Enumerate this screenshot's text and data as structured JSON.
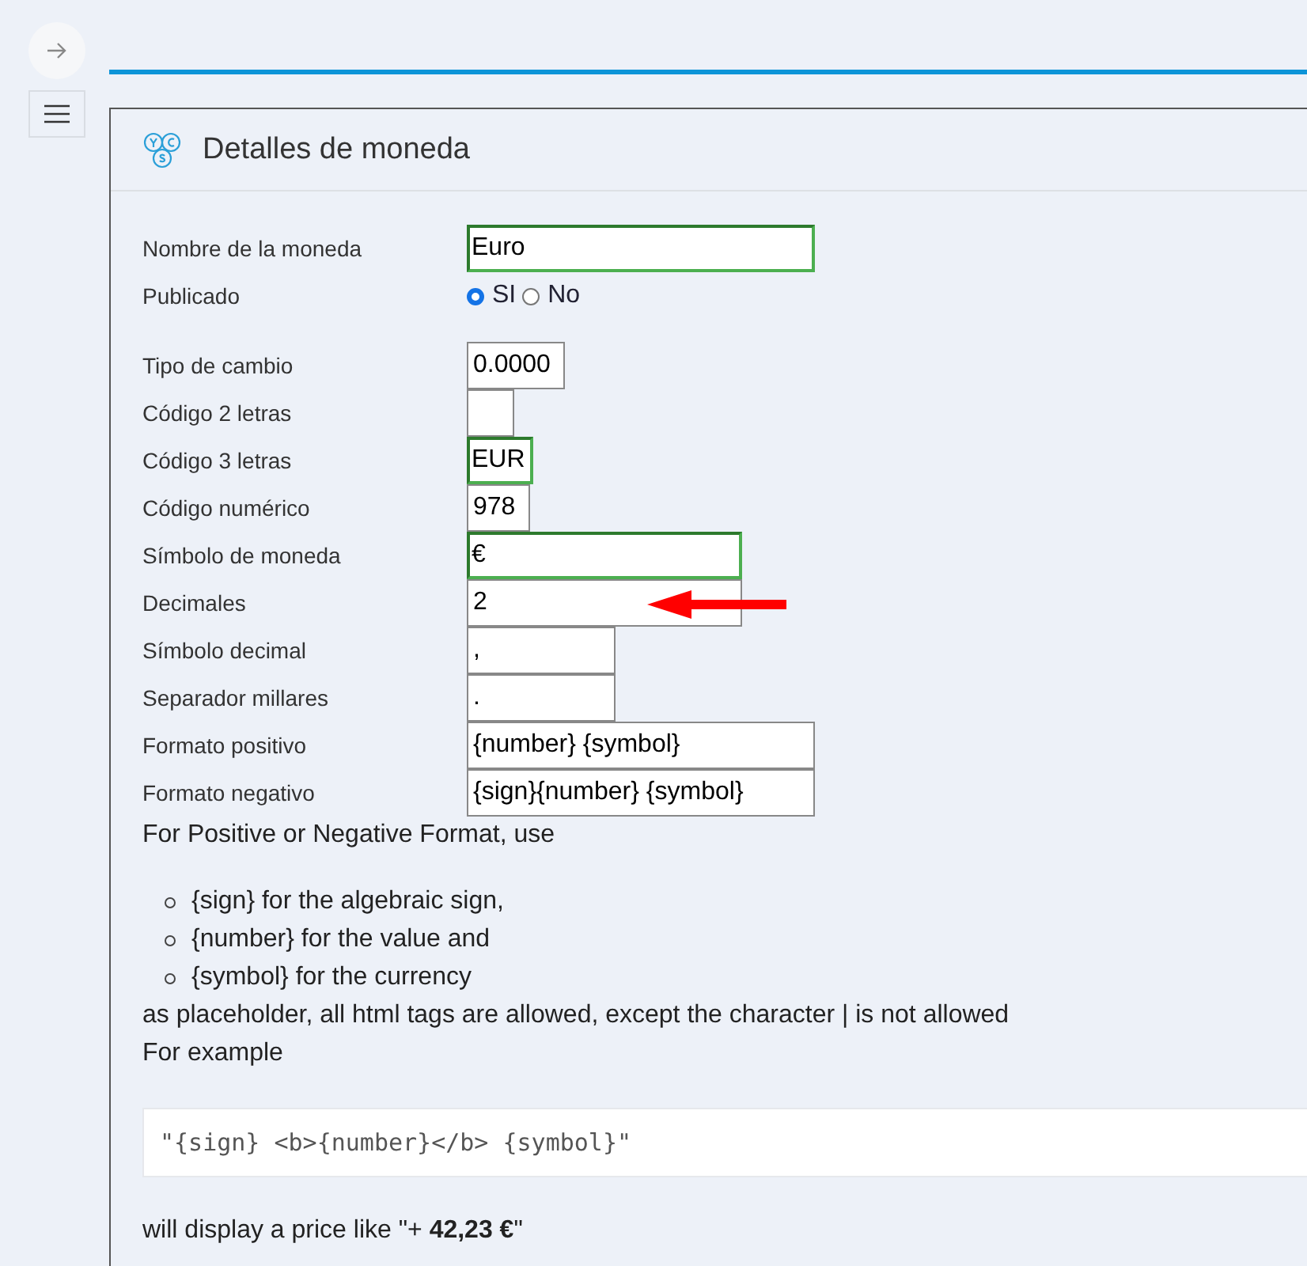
{
  "panel": {
    "title": "Detalles de moneda"
  },
  "fields": [
    {
      "kind": "text",
      "label": "Nombre de la moneda",
      "value": "Euro",
      "valid": true
    },
    {
      "kind": "radio",
      "label": "Publicado",
      "options": [
        {
          "label": "SI",
          "selected": true
        },
        {
          "label": "No",
          "selected": false
        }
      ]
    },
    {
      "kind": "text",
      "label": "Tipo de cambio",
      "value": "0.0000",
      "valid": false
    },
    {
      "kind": "text",
      "label": "Código 2 letras",
      "valid": false
    },
    {
      "kind": "text",
      "label": "Código 3 letras",
      "value": "EUR",
      "valid": true
    },
    {
      "kind": "text",
      "label": "Código numérico",
      "value": "978",
      "valid": false
    },
    {
      "kind": "text",
      "label": "Símbolo de moneda",
      "value": "€",
      "valid": true
    },
    {
      "kind": "text",
      "label": "Decimales",
      "value": "2",
      "valid": false,
      "pointer": true
    },
    {
      "kind": "text",
      "label": "Símbolo decimal",
      "value": ",",
      "valid": false
    },
    {
      "kind": "text",
      "label": "Separador millares",
      "value": ".",
      "valid": false
    },
    {
      "kind": "text",
      "label": "Formato positivo",
      "value": "{number} {symbol}",
      "valid": false
    },
    {
      "kind": "text",
      "label": "Formato negativo",
      "value": "{sign}{number} {symbol}",
      "valid": false
    }
  ],
  "help": {
    "intro": "For Positive or Negative Format, use",
    "items": [
      "{sign} for the algebraic sign,",
      "{number} for the value and",
      "{symbol} for the currency"
    ],
    "note": "as placeholder, all html tags are allowed, except the character | is not allowed",
    "example_label": "For example",
    "code": "\"{sign} <b>{number}</b> {symbol}\"",
    "result": "will display a price like \"+ **42,23 €**\""
  }
}
